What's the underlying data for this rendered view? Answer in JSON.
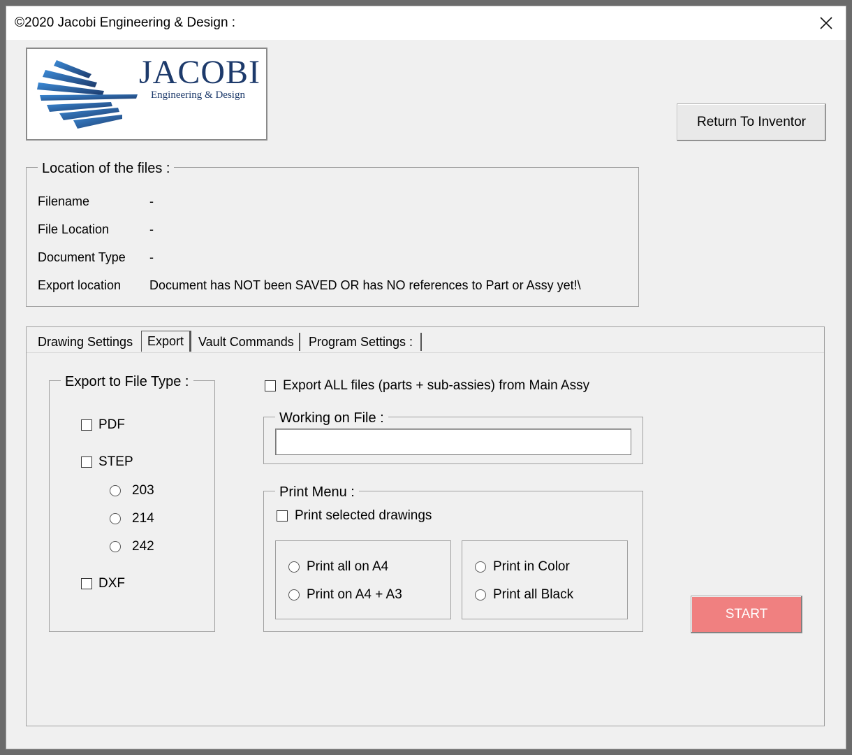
{
  "window": {
    "title": "©2020 Jacobi Engineering & Design :"
  },
  "logo": {
    "word": "JACOBI",
    "sub": "Engineering & Design"
  },
  "return_button": "Return To Inventor",
  "location": {
    "legend": "Location of the files :",
    "rows": [
      {
        "label": "Filename",
        "value": "-"
      },
      {
        "label": "File Location",
        "value": "-"
      },
      {
        "label": "Document Type",
        "value": "-"
      },
      {
        "label": "Export location",
        "value": "Document has NOT been SAVED OR has NO references to Part or Assy yet!\\"
      }
    ]
  },
  "tabs": {
    "items": [
      "Drawing Settings",
      "Export",
      "Vault Commands",
      "Program Settings :"
    ],
    "active": "Export"
  },
  "export": {
    "filetype_legend": "Export to File Type :",
    "pdf": "PDF",
    "step": "STEP",
    "step_versions": [
      "203",
      "214",
      "242"
    ],
    "dxf": "DXF",
    "export_all": "Export ALL files (parts + sub-assies) from Main Assy",
    "working_legend": "Working on File :",
    "working_value": "",
    "print_legend": "Print Menu :",
    "print_selected": "Print selected drawings",
    "print_size": [
      "Print all on A4",
      "Print on A4 + A3"
    ],
    "print_color": [
      "Print in Color",
      "Print all Black"
    ],
    "start": "START"
  },
  "colors": {
    "start_bg": "#f08080",
    "logo_text": "#1d3a6b",
    "logo_stripes": "#2e6db5"
  }
}
